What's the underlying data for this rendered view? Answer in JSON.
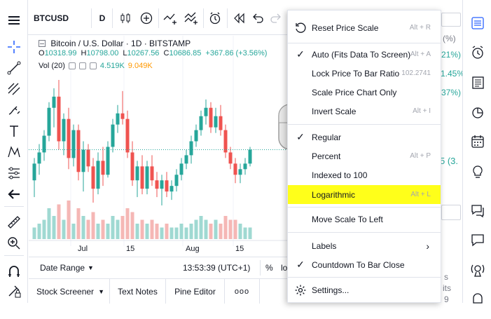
{
  "top_bar": {
    "symbol": "BTCUSD",
    "interval": "D"
  },
  "legend": {
    "title": "Bitcoin / U.S. Dollar · 1D · BITSTAMP",
    "open_label": "O",
    "open": "10318.99",
    "high_label": "H",
    "high": "10798.00",
    "low_label": "L",
    "low": "10267.56",
    "close_label": "C",
    "close": "10686.85",
    "change": "+367.86 (+3.56%)",
    "vol_label": "Vol (20)",
    "vol_value1": "4.519K",
    "vol_value2": "9.049K"
  },
  "time_axis": {
    "labels": [
      "Jul",
      "15",
      "Aug",
      "15"
    ]
  },
  "bottom_info": {
    "date_range": "Date Range",
    "time": "13:53:39 (UTC+1)",
    "percent": "%",
    "log": "lo"
  },
  "bottom_tabs": {
    "stock_screener": "Stock Screener",
    "text_notes": "Text Notes",
    "pine_editor": "Pine Editor",
    "more": "ooo"
  },
  "right_panel": {
    "values": [
      "(%)",
      "21%)",
      "1.45%",
      "37%)",
      "5 (3.",
      "s",
      "its",
      "9"
    ]
  },
  "context_menu": {
    "items": [
      {
        "label": "Reset Price Scale",
        "shortcut": "Alt + R",
        "checked": false
      },
      {
        "label": "Auto (Fits Data To Screen)",
        "shortcut": "Alt + A",
        "checked": true
      },
      {
        "label": "Lock Price To Bar Ratio",
        "shortcut": "102.2741",
        "checked": false
      },
      {
        "label": "Scale Price Chart Only",
        "shortcut": "",
        "checked": false
      },
      {
        "label": "Invert Scale",
        "shortcut": "Alt + I",
        "checked": false
      },
      {
        "label": "Regular",
        "shortcut": "",
        "checked": true
      },
      {
        "label": "Percent",
        "shortcut": "Alt + P",
        "checked": false
      },
      {
        "label": "Indexed to 100",
        "shortcut": "",
        "checked": false
      },
      {
        "label": "Logarithmic",
        "shortcut": "Alt + L",
        "checked": false,
        "highlighted": true
      },
      {
        "label": "Move Scale To Left",
        "shortcut": "",
        "checked": false
      },
      {
        "label": "Labels",
        "shortcut": "",
        "checked": false,
        "submenu": true
      },
      {
        "label": "Countdown To Bar Close",
        "shortcut": "",
        "checked": true
      },
      {
        "label": "Settings...",
        "shortcut": "",
        "checked": false
      }
    ]
  },
  "colors": {
    "up": "#26a69a",
    "down": "#ef5350",
    "highlight": "#ffff1a",
    "accent": "#2962ff"
  },
  "chart_data": {
    "type": "candlestick",
    "candles": [
      [
        9.6,
        10.4,
        9.0,
        10.2
      ],
      [
        10.2,
        10.9,
        9.8,
        10.6
      ],
      [
        10.6,
        11.4,
        10.3,
        11.2
      ],
      [
        11.2,
        12.4,
        11.0,
        12.2
      ],
      [
        12.2,
        12.9,
        11.5,
        12.6
      ],
      [
        12.6,
        13.2,
        10.7,
        11.0
      ],
      [
        11.0,
        12.0,
        10.5,
        11.8
      ],
      [
        11.8,
        12.2,
        10.0,
        10.4
      ],
      [
        10.4,
        11.6,
        10.1,
        11.4
      ],
      [
        11.4,
        11.6,
        9.6,
        9.9
      ],
      [
        9.9,
        11.0,
        9.2,
        10.7
      ],
      [
        10.7,
        10.9,
        9.9,
        10.1
      ],
      [
        10.1,
        10.4,
        8.8,
        9.3
      ],
      [
        9.3,
        10.6,
        9.1,
        10.3
      ],
      [
        10.3,
        10.8,
        9.4,
        9.8
      ],
      [
        9.8,
        11.0,
        9.7,
        10.8
      ],
      [
        10.8,
        11.8,
        10.6,
        11.6
      ],
      [
        11.6,
        12.3,
        11.3,
        12.0
      ],
      [
        12.0,
        12.8,
        11.6,
        11.8
      ],
      [
        11.8,
        12.1,
        10.4,
        10.6
      ],
      [
        10.6,
        11.0,
        9.4,
        9.6
      ],
      [
        9.6,
        10.3,
        9.0,
        10.1
      ],
      [
        10.1,
        10.5,
        9.1,
        9.3
      ],
      [
        9.3,
        10.3,
        9.1,
        10.1
      ],
      [
        10.1,
        10.5,
        9.4,
        9.6
      ],
      [
        9.6,
        9.9,
        9.0,
        9.3
      ],
      [
        9.3,
        9.8,
        8.7,
        9.6
      ],
      [
        9.6,
        9.9,
        9.0,
        9.2
      ],
      [
        9.2,
        9.6,
        8.9,
        9.4
      ],
      [
        9.4,
        10.0,
        9.2,
        9.8
      ],
      [
        9.8,
        10.4,
        9.6,
        10.2
      ],
      [
        10.2,
        10.7,
        10.0,
        10.5
      ],
      [
        10.5,
        11.2,
        10.2,
        11.0
      ],
      [
        11.0,
        11.6,
        10.8,
        11.4
      ],
      [
        11.4,
        12.1,
        11.2,
        11.9
      ],
      [
        11.9,
        12.5,
        11.6,
        12.2
      ],
      [
        12.2,
        12.4,
        11.3,
        11.5
      ],
      [
        11.5,
        12.2,
        11.3,
        11.9
      ],
      [
        11.9,
        12.3,
        11.2,
        11.4
      ],
      [
        11.4,
        11.6,
        10.4,
        10.6
      ],
      [
        10.6,
        10.8,
        10.0,
        10.2
      ],
      [
        10.2,
        10.4,
        9.5,
        9.8
      ],
      [
        9.8,
        10.2,
        9.5,
        10.0
      ],
      [
        10.0,
        10.4,
        9.8,
        10.2
      ],
      [
        10.2,
        10.8,
        10.1,
        10.7
      ]
    ],
    "volumes": [
      3,
      4,
      5,
      8,
      6,
      9,
      5,
      10,
      4,
      8,
      6,
      5,
      7,
      4,
      5,
      4,
      6,
      5,
      6,
      8,
      7,
      4,
      5,
      4,
      5,
      4,
      3,
      4,
      3,
      3,
      4,
      3,
      4,
      5,
      6,
      5,
      4,
      5,
      4,
      6,
      5,
      5,
      4,
      3,
      3
    ]
  }
}
